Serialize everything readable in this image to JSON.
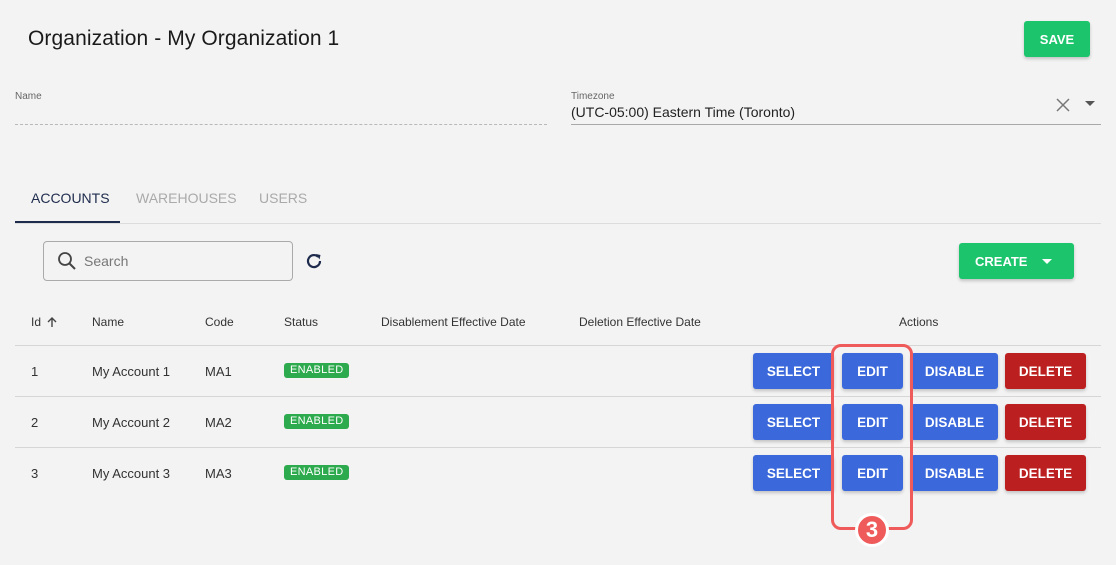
{
  "header": {
    "title": "Organization - My Organization 1",
    "save_label": "SAVE"
  },
  "form": {
    "name_label": "Name",
    "name_value": "",
    "timezone_label": "Timezone",
    "timezone_value": "(UTC-05:00) Eastern Time (Toronto)"
  },
  "tabs": [
    {
      "label": "ACCOUNTS",
      "active": true
    },
    {
      "label": "WAREHOUSES",
      "active": false
    },
    {
      "label": "USERS",
      "active": false
    }
  ],
  "toolbar": {
    "search_placeholder": "Search",
    "create_label": "CREATE"
  },
  "table": {
    "columns": [
      "Id",
      "Name",
      "Code",
      "Status",
      "Disablement Effective Date",
      "Deletion Effective Date",
      "Actions"
    ],
    "rows": [
      {
        "id": "1",
        "name": "My Account 1",
        "code": "MA1",
        "status": "ENABLED",
        "disablement_date": "",
        "deletion_date": ""
      },
      {
        "id": "2",
        "name": "My Account 2",
        "code": "MA2",
        "status": "ENABLED",
        "disablement_date": "",
        "deletion_date": ""
      },
      {
        "id": "3",
        "name": "My Account 3",
        "code": "MA3",
        "status": "ENABLED",
        "disablement_date": "",
        "deletion_date": ""
      }
    ],
    "actions": {
      "select": "SELECT",
      "edit": "EDIT",
      "disable": "DISABLE",
      "delete": "DELETE"
    }
  },
  "annotation": {
    "step_number": "3"
  },
  "colors": {
    "primary_green": "#1cc46c",
    "action_blue": "#3b68da",
    "danger_red": "#bc1f1f",
    "status_green": "#2eaa4e",
    "highlight_red": "#ef5b5b",
    "tab_active": "#1e2b4d"
  }
}
